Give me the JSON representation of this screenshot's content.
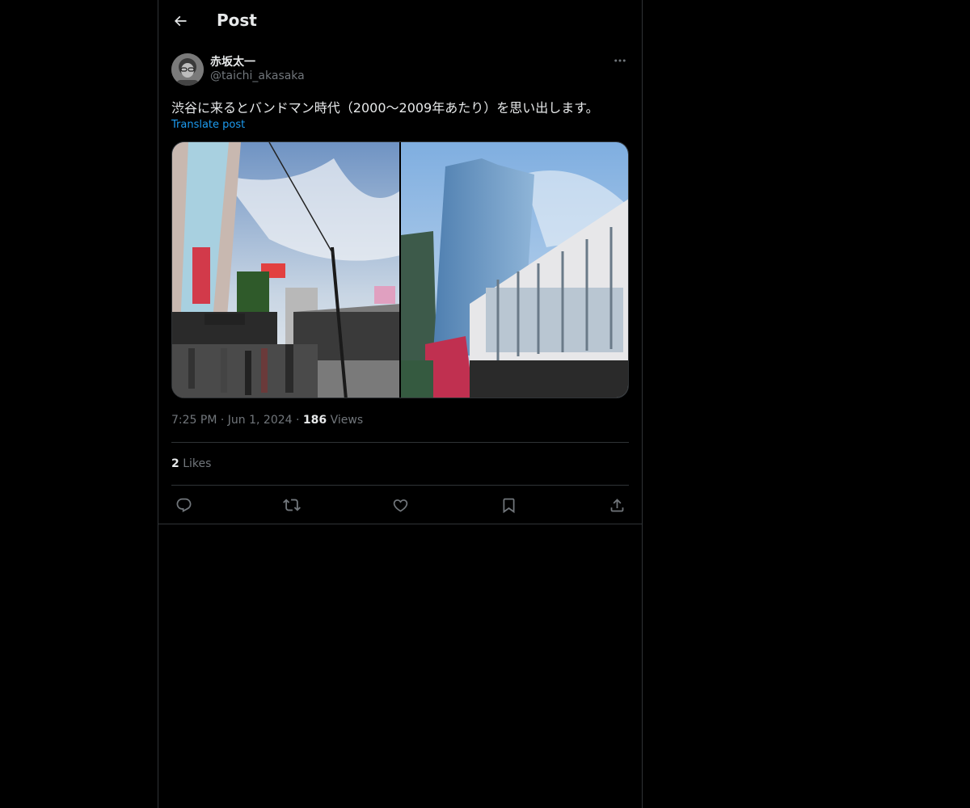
{
  "header": {
    "title": "Post",
    "back_icon": "arrow-left-icon"
  },
  "post": {
    "author_name": "赤坂太一",
    "author_handle": "@taichi_akasaka",
    "text": "渋谷に来るとバンドマン時代（2000〜2009年あたり）を思い出します。",
    "translate_label": "Translate post",
    "images": [
      {
        "name": "shibuya-street-photo"
      },
      {
        "name": "shibuya-station-tower-photo"
      }
    ],
    "time": "7:25 PM",
    "date": "Jun 1, 2024",
    "views_count": "186",
    "views_label": "Views",
    "likes_count": "2",
    "likes_label": "Likes"
  },
  "actions": [
    {
      "icon": "reply-icon"
    },
    {
      "icon": "repost-icon"
    },
    {
      "icon": "like-icon"
    },
    {
      "icon": "bookmark-icon"
    },
    {
      "icon": "share-icon"
    }
  ],
  "colors": {
    "background": "#000000",
    "text": "#e7e9ea",
    "secondary": "#71767b",
    "link": "#1d9bf0",
    "border": "#2f3336"
  }
}
